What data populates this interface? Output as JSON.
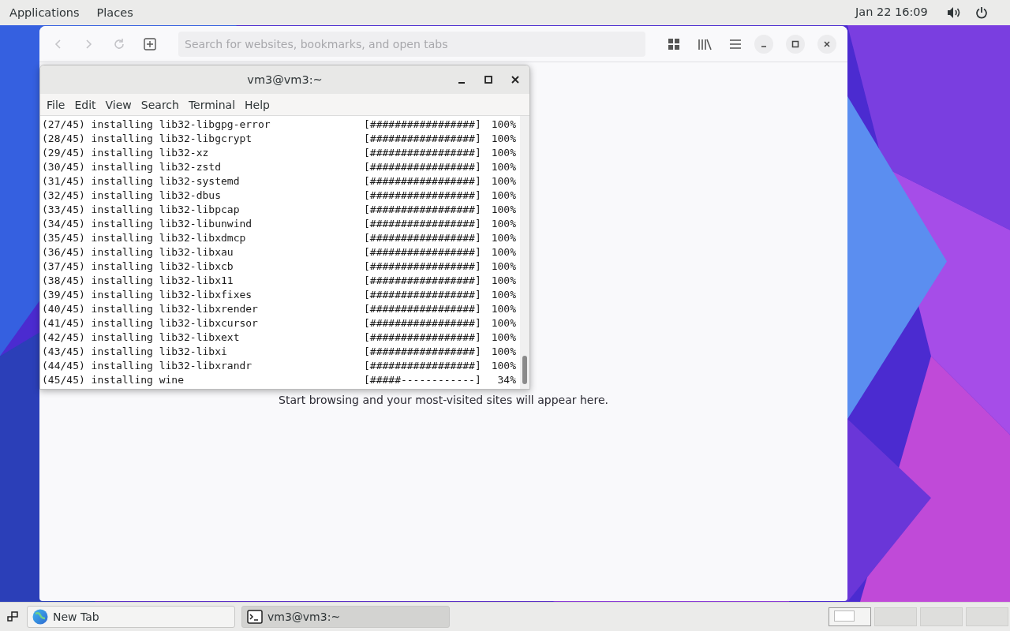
{
  "top_bar": {
    "menus": [
      "Applications",
      "Places"
    ],
    "clock": "Jan 22  16:09"
  },
  "browser": {
    "search": {
      "placeholder": "Search for websites, bookmarks, and open tabs"
    },
    "message": "Start browsing and your most-visited sites will appear here."
  },
  "terminal": {
    "title": "vm3@vm3:~",
    "menu": [
      "File",
      "Edit",
      "View",
      "Search",
      "Terminal",
      "Help"
    ],
    "lines": [
      {
        "text": "(27/45) installing lib32-libgpg-error",
        "bar": "[#################]",
        "percent": "100%"
      },
      {
        "text": "(28/45) installing lib32-libgcrypt",
        "bar": "[#################]",
        "percent": "100%"
      },
      {
        "text": "(29/45) installing lib32-xz",
        "bar": "[#################]",
        "percent": "100%"
      },
      {
        "text": "(30/45) installing lib32-zstd",
        "bar": "[#################]",
        "percent": "100%"
      },
      {
        "text": "(31/45) installing lib32-systemd",
        "bar": "[#################]",
        "percent": "100%"
      },
      {
        "text": "(32/45) installing lib32-dbus",
        "bar": "[#################]",
        "percent": "100%"
      },
      {
        "text": "(33/45) installing lib32-libpcap",
        "bar": "[#################]",
        "percent": "100%"
      },
      {
        "text": "(34/45) installing lib32-libunwind",
        "bar": "[#################]",
        "percent": "100%"
      },
      {
        "text": "(35/45) installing lib32-libxdmcp",
        "bar": "[#################]",
        "percent": "100%"
      },
      {
        "text": "(36/45) installing lib32-libxau",
        "bar": "[#################]",
        "percent": "100%"
      },
      {
        "text": "(37/45) installing lib32-libxcb",
        "bar": "[#################]",
        "percent": "100%"
      },
      {
        "text": "(38/45) installing lib32-libx11",
        "bar": "[#################]",
        "percent": "100%"
      },
      {
        "text": "(39/45) installing lib32-libxfixes",
        "bar": "[#################]",
        "percent": "100%"
      },
      {
        "text": "(40/45) installing lib32-libxrender",
        "bar": "[#################]",
        "percent": "100%"
      },
      {
        "text": "(41/45) installing lib32-libxcursor",
        "bar": "[#################]",
        "percent": "100%"
      },
      {
        "text": "(42/45) installing lib32-libxext",
        "bar": "[#################]",
        "percent": "100%"
      },
      {
        "text": "(43/45) installing lib32-libxi",
        "bar": "[#################]",
        "percent": "100%"
      },
      {
        "text": "(44/45) installing lib32-libxrandr",
        "bar": "[#################]",
        "percent": "100%"
      },
      {
        "text": "(45/45) installing wine",
        "bar": "[#####------------]",
        "percent": "34%"
      }
    ]
  },
  "taskbar": {
    "items": [
      {
        "label": "New Tab",
        "kind": "browser",
        "selected": false
      },
      {
        "label": "vm3@vm3:~",
        "kind": "terminal",
        "selected": true
      }
    ],
    "workspaces": [
      {
        "selected": true
      },
      {
        "selected": false
      },
      {
        "selected": false
      },
      {
        "selected": false
      }
    ]
  }
}
